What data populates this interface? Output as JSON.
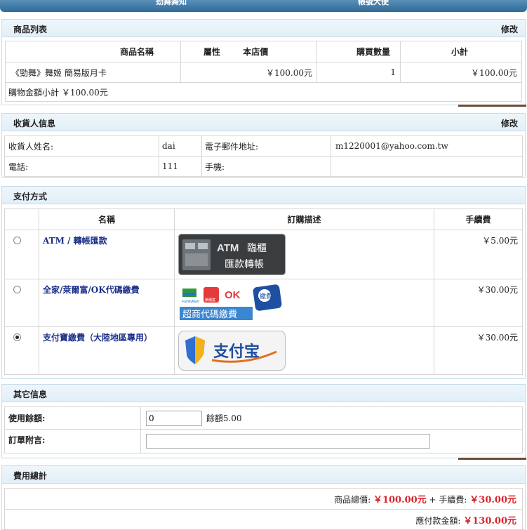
{
  "topbar": {
    "left_tab": "劲舞舞知",
    "right_tab": "帳號大使"
  },
  "products": {
    "title": "商品列表",
    "edit": "修改",
    "headers": {
      "name": "商品名稱",
      "attr": "屬性",
      "price": "本店價",
      "qty": "購買數量",
      "subtotal": "小計"
    },
    "rows": [
      {
        "name": "《勁舞》舞姬 簡易版月卡",
        "price": "￥100.00元",
        "qty": "1",
        "subtotal": "￥100.00元"
      }
    ],
    "total_text": "購物金額小計 ￥100.00元"
  },
  "consignee": {
    "title": "收貨人信息",
    "edit": "修改",
    "name_label": "收貨人姓名:",
    "name_value": "dai",
    "email_label": "電子郵件地址:",
    "email_value": "m1220001@yahoo.com.tw",
    "phone_label": "電話:",
    "phone_value": "111",
    "mobile_label": "手機:",
    "mobile_value": ""
  },
  "payment": {
    "title": "支付方式",
    "headers": {
      "name": "名稱",
      "desc": "訂購描述",
      "fee": "手續費"
    },
    "methods": [
      {
        "name": "ATM / 轉帳匯款",
        "fee": "￥5.00元",
        "badge_top": "ATM",
        "badge_top2": "臨櫃",
        "badge_bottom": "匯款轉帳"
      },
      {
        "name": "全家/萊爾富/OK代碼繳費",
        "fee": "￥30.00元",
        "banner": "超商代碼繳費",
        "logo1": "FamilyMart",
        "logo2": "OK",
        "logo3": "萊爾富",
        "logo4": "繳費"
      },
      {
        "name": "支付寶繳費（大陸地區專用）",
        "fee": "￥30.00元",
        "logo_text": "支付宝"
      }
    ]
  },
  "other": {
    "title": "其它信息",
    "balance_label": "使用餘額:",
    "balance_value": "0",
    "balance_note": "餘額5.00",
    "note_label": "訂單附言:",
    "note_value": ""
  },
  "summary": {
    "title": "費用總計",
    "goods_label": "商品總價:",
    "goods_value": "￥100.00元",
    "plus_fee_label": "+ 手續費:",
    "fee_value": "￥30.00元",
    "pay_label": "應付款金額:",
    "pay_value": "￥130.00元"
  },
  "colors": {
    "accent_red": "#d8242a",
    "link_blue": "#1b2f8a",
    "header_blue": "#e2eff7"
  }
}
